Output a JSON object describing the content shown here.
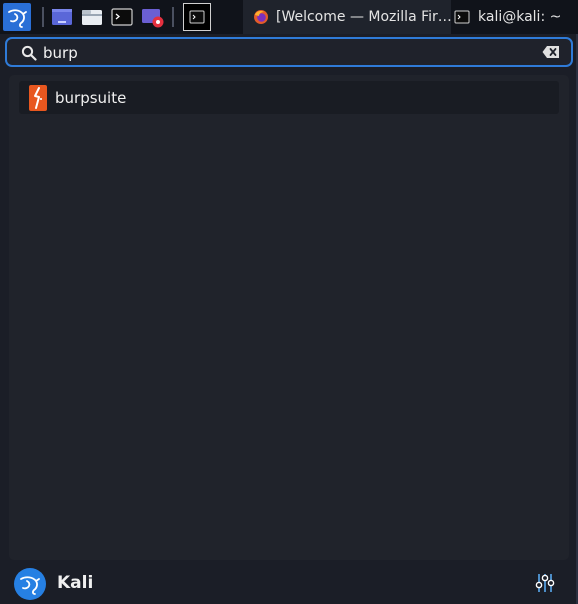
{
  "taskbar": {
    "tasks": [
      {
        "label": "[Welcome — Mozilla Fir…",
        "icon": "firefox-icon"
      },
      {
        "label": "kali@kali: ~",
        "icon": "terminal-icon"
      }
    ]
  },
  "search": {
    "query": "burp",
    "placeholder": ""
  },
  "results": [
    {
      "label": "burpsuite",
      "icon": "burpsuite-icon"
    }
  ],
  "user": {
    "name": "Kali"
  },
  "colors": {
    "accent": "#2f7bd8",
    "panel": "#10131a",
    "background": "#1b1e27",
    "burp_orange": "#e8571f"
  }
}
